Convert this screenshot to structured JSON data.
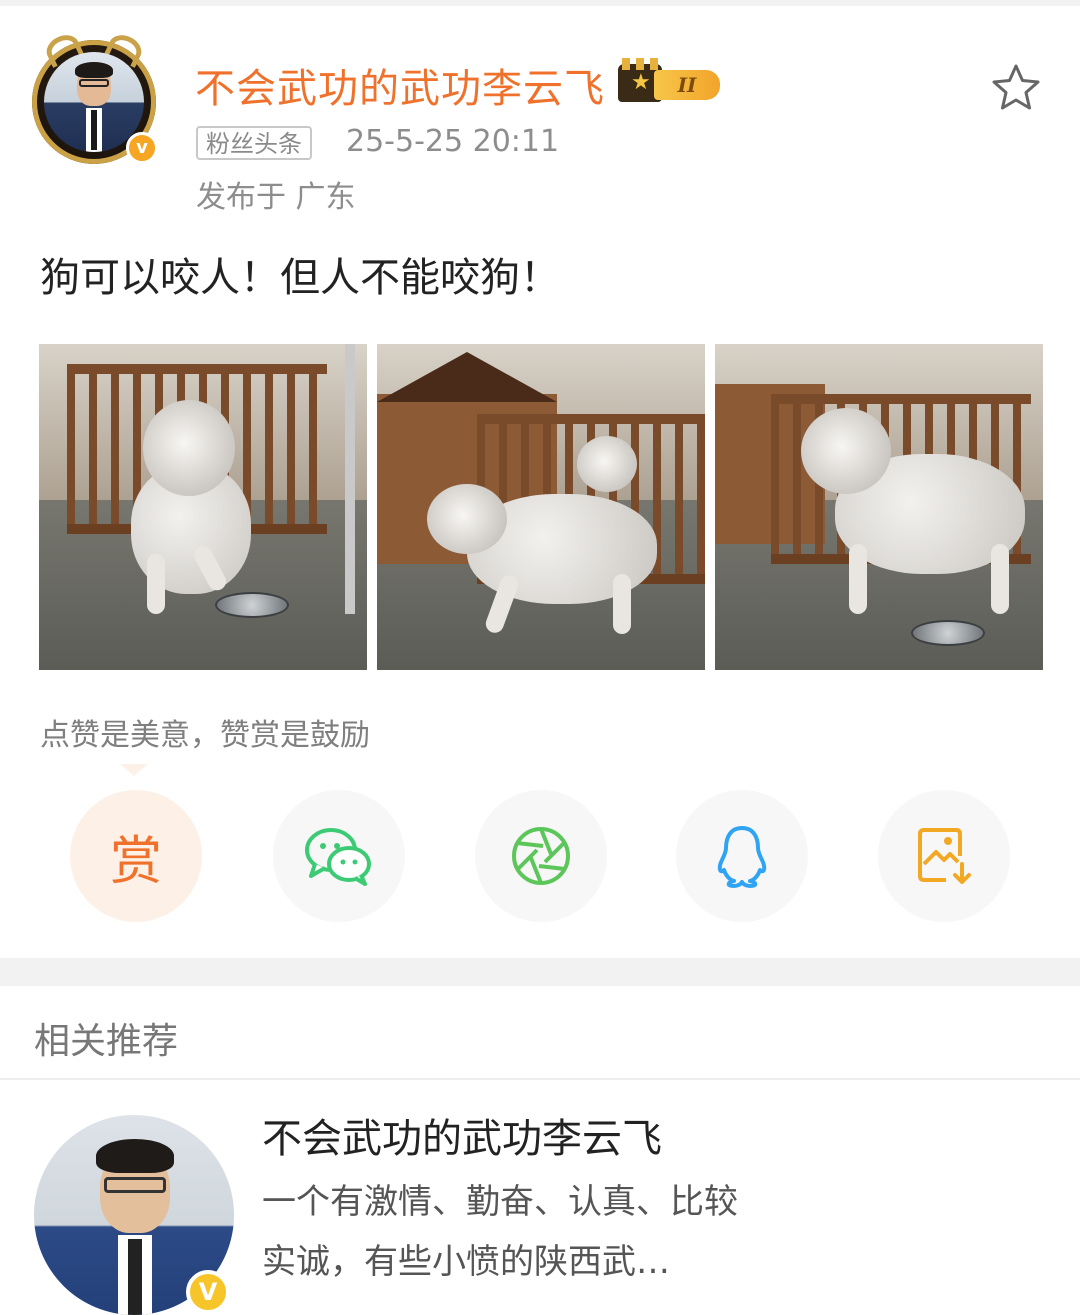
{
  "post": {
    "username": "不会武功的武功李云飞",
    "level_badge": "II",
    "source_tag": "粉丝头条",
    "time": "25-5-25 20:11",
    "location": "发布于 广东",
    "text": "狗可以咬人！但人不能咬狗！",
    "verified_icon": "v-verified-icon",
    "favorite_icon": "star-outline-icon"
  },
  "photos": [
    {
      "icon": "dog-photo"
    },
    {
      "icon": "dog-photo"
    },
    {
      "icon": "dog-photo"
    }
  ],
  "reward": {
    "prompt": "点赞是美意，赞赏是鼓励",
    "reward_label": "赏"
  },
  "share": {
    "items": [
      {
        "icon": "wechat-icon"
      },
      {
        "icon": "wechat-moments-icon"
      },
      {
        "icon": "qq-icon"
      },
      {
        "icon": "save-image-icon"
      }
    ]
  },
  "recommend": {
    "title": "相关推荐",
    "name": "不会武功的武功李云飞",
    "description": "一个有激情、勤奋、认真、比较实诚，有些小愤的陕西武…",
    "verified_label": "V"
  },
  "colors": {
    "username": "#f0712b",
    "reward_orange": "#f0712b",
    "wechat_green": "#3ccb74",
    "moments_green": "#5dc65a",
    "qq_blue": "#2fa4f4",
    "save_orange": "#f3a824"
  }
}
